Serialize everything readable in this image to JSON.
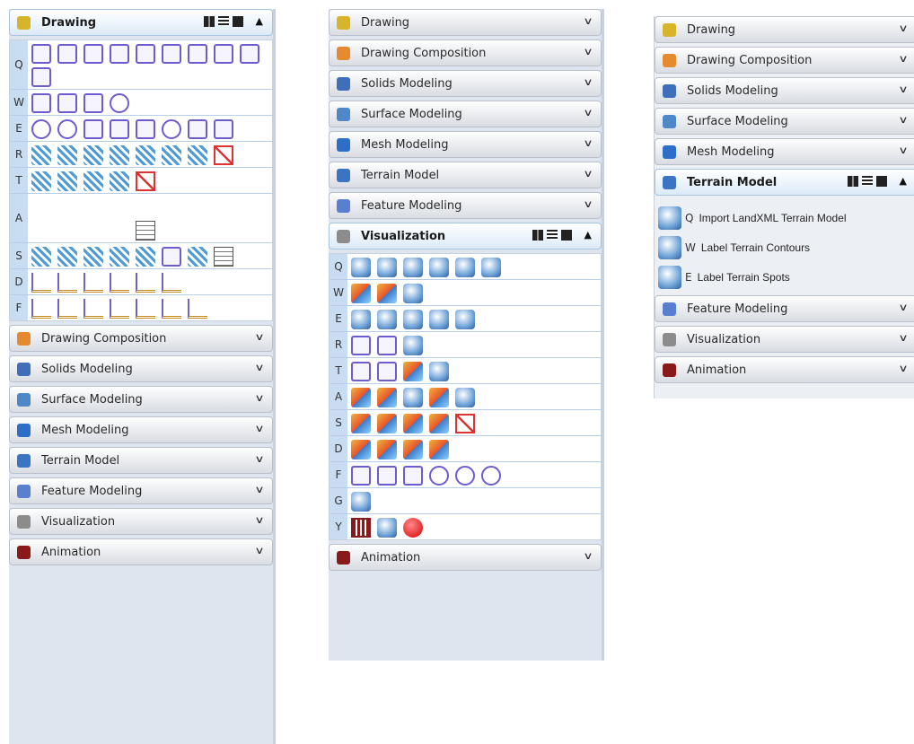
{
  "panels": [
    {
      "headers_above": [],
      "active": "Drawing",
      "rows": [
        {
          "key": "Q",
          "tools": [
            "t-line",
            "t-line",
            "t-line",
            "t-line",
            "t-line",
            "t-line",
            "t-line",
            "t-line",
            "t-line",
            "t-line"
          ]
        },
        {
          "key": "W",
          "tools": [
            "t-line",
            "t-line",
            "t-line",
            "t-circ"
          ]
        },
        {
          "key": "E",
          "tools": [
            "t-circ",
            "t-circ",
            "t-line",
            "t-line",
            "t-line",
            "t-circ",
            "t-line",
            "t-line"
          ]
        },
        {
          "key": "R",
          "tools": [
            "t-pat",
            "t-pat",
            "t-pat",
            "t-pat",
            "t-pat",
            "t-pat",
            "t-pat",
            "t-check"
          ]
        },
        {
          "key": "T",
          "tools": [
            "t-pat",
            "t-pat",
            "t-pat",
            "t-pat",
            "t-check"
          ]
        },
        {
          "key": "A",
          "tools": [
            "t-text",
            "t-text",
            "t-text",
            "t-text",
            "t-text",
            "t-text",
            "t-text",
            "t-text",
            "t-text",
            "t-text",
            "t-text",
            "t-text",
            "t-text",
            "t-grid"
          ]
        },
        {
          "key": "S",
          "tools": [
            "t-pat",
            "t-pat",
            "t-pat",
            "t-pat",
            "t-pat",
            "t-line",
            "t-pat",
            "t-grid"
          ]
        },
        {
          "key": "D",
          "tools": [
            "t-dim",
            "t-dim",
            "t-dim",
            "t-dim",
            "t-dim",
            "t-dim"
          ]
        },
        {
          "key": "F",
          "tools": [
            "t-dim",
            "t-dim",
            "t-dim",
            "t-dim",
            "t-dim",
            "t-dim",
            "t-dim"
          ]
        }
      ],
      "headers_below": [
        "Drawing Composition",
        "Solids Modeling",
        "Surface Modeling",
        "Mesh Modeling",
        "Terrain Model",
        "Feature Modeling",
        "Visualization",
        "Animation"
      ]
    },
    {
      "headers_above": [
        "Drawing",
        "Drawing Composition",
        "Solids Modeling",
        "Surface Modeling",
        "Mesh Modeling",
        "Terrain Model",
        "Feature Modeling"
      ],
      "active": "Visualization",
      "rows": [
        {
          "key": "Q",
          "tools": [
            "t-vis",
            "t-vis",
            "t-vis",
            "t-vis",
            "t-vis",
            "t-vis"
          ]
        },
        {
          "key": "W",
          "tools": [
            "t-mix",
            "t-mix",
            "t-vis"
          ]
        },
        {
          "key": "E",
          "tools": [
            "t-vis",
            "t-vis",
            "t-vis",
            "t-vis",
            "t-vis"
          ]
        },
        {
          "key": "R",
          "tools": [
            "t-line",
            "t-line",
            "t-vis"
          ]
        },
        {
          "key": "T",
          "tools": [
            "t-line",
            "t-line",
            "t-mix",
            "t-vis"
          ]
        },
        {
          "key": "A",
          "tools": [
            "t-mix",
            "t-mix",
            "t-vis",
            "t-mix",
            "t-vis"
          ]
        },
        {
          "key": "S",
          "tools": [
            "t-mix",
            "t-mix",
            "t-mix",
            "t-mix",
            "t-check"
          ]
        },
        {
          "key": "D",
          "tools": [
            "t-mix",
            "t-mix",
            "t-mix",
            "t-mix"
          ]
        },
        {
          "key": "F",
          "tools": [
            "t-line",
            "t-line",
            "t-line",
            "t-circ",
            "t-circ",
            "t-circ"
          ]
        },
        {
          "key": "G",
          "tools": [
            "t-vis"
          ]
        },
        {
          "key": "Y",
          "tools": [
            "t-film",
            "t-vis",
            "t-red"
          ]
        }
      ],
      "headers_below": [
        "Animation"
      ]
    }
  ],
  "panel3": {
    "headers_above": [
      "Drawing",
      "Drawing Composition",
      "Solids Modeling",
      "Surface Modeling",
      "Mesh Modeling"
    ],
    "active": "Terrain Model",
    "items": [
      {
        "key": "Q",
        "label": "Import LandXML Terrain Model"
      },
      {
        "key": "W",
        "label": "Label Terrain Contours"
      },
      {
        "key": "E",
        "label": "Label Terrain Spots"
      }
    ],
    "headers_below": [
      "Feature Modeling",
      "Visualization",
      "Animation"
    ]
  },
  "icons": {
    "Drawing": "drawing-icon",
    "Drawing Composition": "drawing-composition-icon",
    "Solids Modeling": "solids-modeling-icon",
    "Surface Modeling": "surface-modeling-icon",
    "Mesh Modeling": "mesh-modeling-icon",
    "Terrain Model": "terrain-model-icon",
    "Feature Modeling": "feature-modeling-icon",
    "Visualization": "visualization-icon",
    "Animation": "animation-icon"
  },
  "icon_colors": {
    "Drawing": "#d8b42a",
    "Drawing Composition": "#e58a2e",
    "Solids Modeling": "#3e6fb8",
    "Surface Modeling": "#4f88c8",
    "Mesh Modeling": "#2d6ec9",
    "Terrain Model": "#3a74c2",
    "Feature Modeling": "#5a7fd0",
    "Visualization": "#8c8c8c",
    "Animation": "#8a1a1a"
  }
}
